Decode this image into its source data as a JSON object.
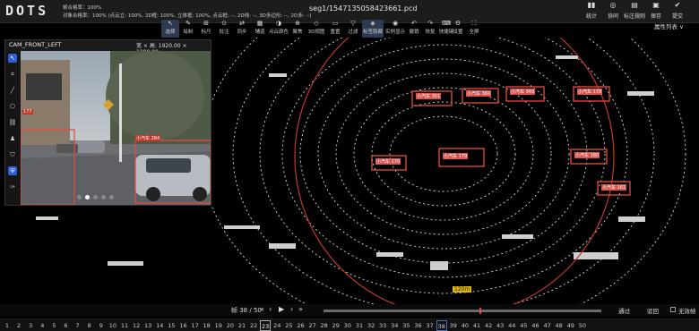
{
  "app": {
    "logo": "DOTS",
    "file_name": "seg1/1547135058423661.pcd"
  },
  "stats": {
    "line1": "帧合格率：100%",
    "line2": "对象合格率：100% (点云立: 100%, 2D框: 100%, 立体框: 100%, 点云框: --, 2D线: --, 3D多边形: --, 2D多: --)"
  },
  "top_right": [
    {
      "name": "stats",
      "label": "统计",
      "icon": "bar-chart-icon"
    },
    {
      "name": "collab",
      "label": "协同",
      "icon": "collab-icon"
    },
    {
      "name": "rules",
      "label": "标注规则",
      "icon": "rules-icon"
    },
    {
      "name": "save",
      "label": "保存",
      "icon": "save-icon"
    },
    {
      "name": "submit",
      "label": "提交",
      "icon": "submit-icon"
    }
  ],
  "toolbar": [
    {
      "name": "select",
      "label": "选择",
      "icon": "cursor-icon",
      "active": true
    },
    {
      "name": "draw",
      "label": "绘制",
      "icon": "pen-icon"
    },
    {
      "name": "mark",
      "label": "标尺",
      "icon": "ruler-icon"
    },
    {
      "name": "annotate",
      "label": "批注",
      "icon": "note-icon"
    },
    {
      "name": "sync",
      "label": "同步",
      "icon": "sync-icon"
    },
    {
      "name": "assist",
      "label": "辅道",
      "icon": "assist-icon"
    },
    {
      "name": "pointcolor",
      "label": "点云颜色",
      "icon": "palette-icon"
    },
    {
      "name": "focus",
      "label": "聚焦",
      "icon": "focus-icon"
    },
    {
      "name": "view3d",
      "label": "3D视图",
      "icon": "cube-icon"
    },
    {
      "name": "reset",
      "label": "重置",
      "icon": "reset-icon"
    },
    {
      "name": "filter",
      "label": "过滤",
      "icon": "filter-icon"
    },
    {
      "name": "hidelabel",
      "label": "标签隐藏",
      "icon": "tag-icon",
      "active": true
    },
    {
      "name": "realtime",
      "label": "实例显示",
      "icon": "eye-icon"
    },
    {
      "name": "undo",
      "label": "撤销",
      "icon": "undo-icon"
    },
    {
      "name": "redo",
      "label": "恢复",
      "icon": "redo-icon"
    },
    {
      "name": "shortcut",
      "label": "快捷键",
      "icon": "keyboard-icon"
    },
    {
      "name": "settings",
      "label": "设置",
      "icon": "gear-icon"
    },
    {
      "name": "fullscreen",
      "label": "全屏",
      "icon": "fullscreen-icon"
    }
  ],
  "attr_list_label": "属性列表 ∨",
  "camera": {
    "title": "CAM_FRONT_LEFT",
    "size_text": "宽 × 高: 1920.00 × 1280.00",
    "box_labels": [
      "小汽车 284",
      "177"
    ],
    "tools": [
      "cursor-icon",
      "crop-icon",
      "line-icon",
      "polygon-icon",
      "link-icon",
      "person-icon",
      "shield-icon",
      "shield-fill-icon",
      "wrench-icon"
    ]
  },
  "cloud_objects": [
    "小汽车 351",
    "小汽车 360",
    "小汽车 349",
    "小汽车 178",
    "小汽车 179",
    "小汽车 170",
    "小汽车 180",
    "小汽车 161"
  ],
  "range_label": "120m",
  "frame": {
    "text": "帧 38 / 50",
    "pass_label": "通过",
    "reject_label": "驳回",
    "invalid_label": "无效帧"
  },
  "pages": [
    "1",
    "2",
    "3",
    "4",
    "5",
    "6",
    "7",
    "8",
    "9",
    "10",
    "11",
    "12",
    "13",
    "14",
    "15",
    "16",
    "17",
    "18",
    "19",
    "20",
    "21",
    "22",
    "23",
    "24",
    "25",
    "26",
    "27",
    "28",
    "29",
    "30",
    "31",
    "32",
    "33",
    "34",
    "35",
    "36",
    "37",
    "38",
    "39",
    "40",
    "41",
    "42",
    "43",
    "44",
    "45",
    "46",
    "47",
    "48",
    "49",
    "50"
  ],
  "current_page": "23",
  "marked_page": "38",
  "colors": {
    "box_red": "#d9534f",
    "range_yellow": "#e0b400",
    "active_blue": "#2f5fd8"
  }
}
